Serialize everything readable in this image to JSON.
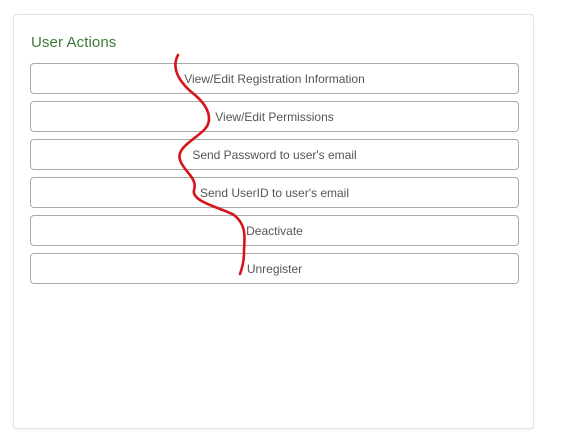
{
  "panel": {
    "title": "User Actions",
    "actions": [
      "View/Edit Registration Information",
      "View/Edit Permissions",
      "Send Password to user's email",
      "Send UserID to user's email",
      "Deactivate",
      "Unregister"
    ]
  },
  "colors": {
    "title": "#3f7a3a",
    "button_border": "#a9a9a9",
    "button_text": "#555555",
    "annotation_stroke": "#d6141b"
  }
}
